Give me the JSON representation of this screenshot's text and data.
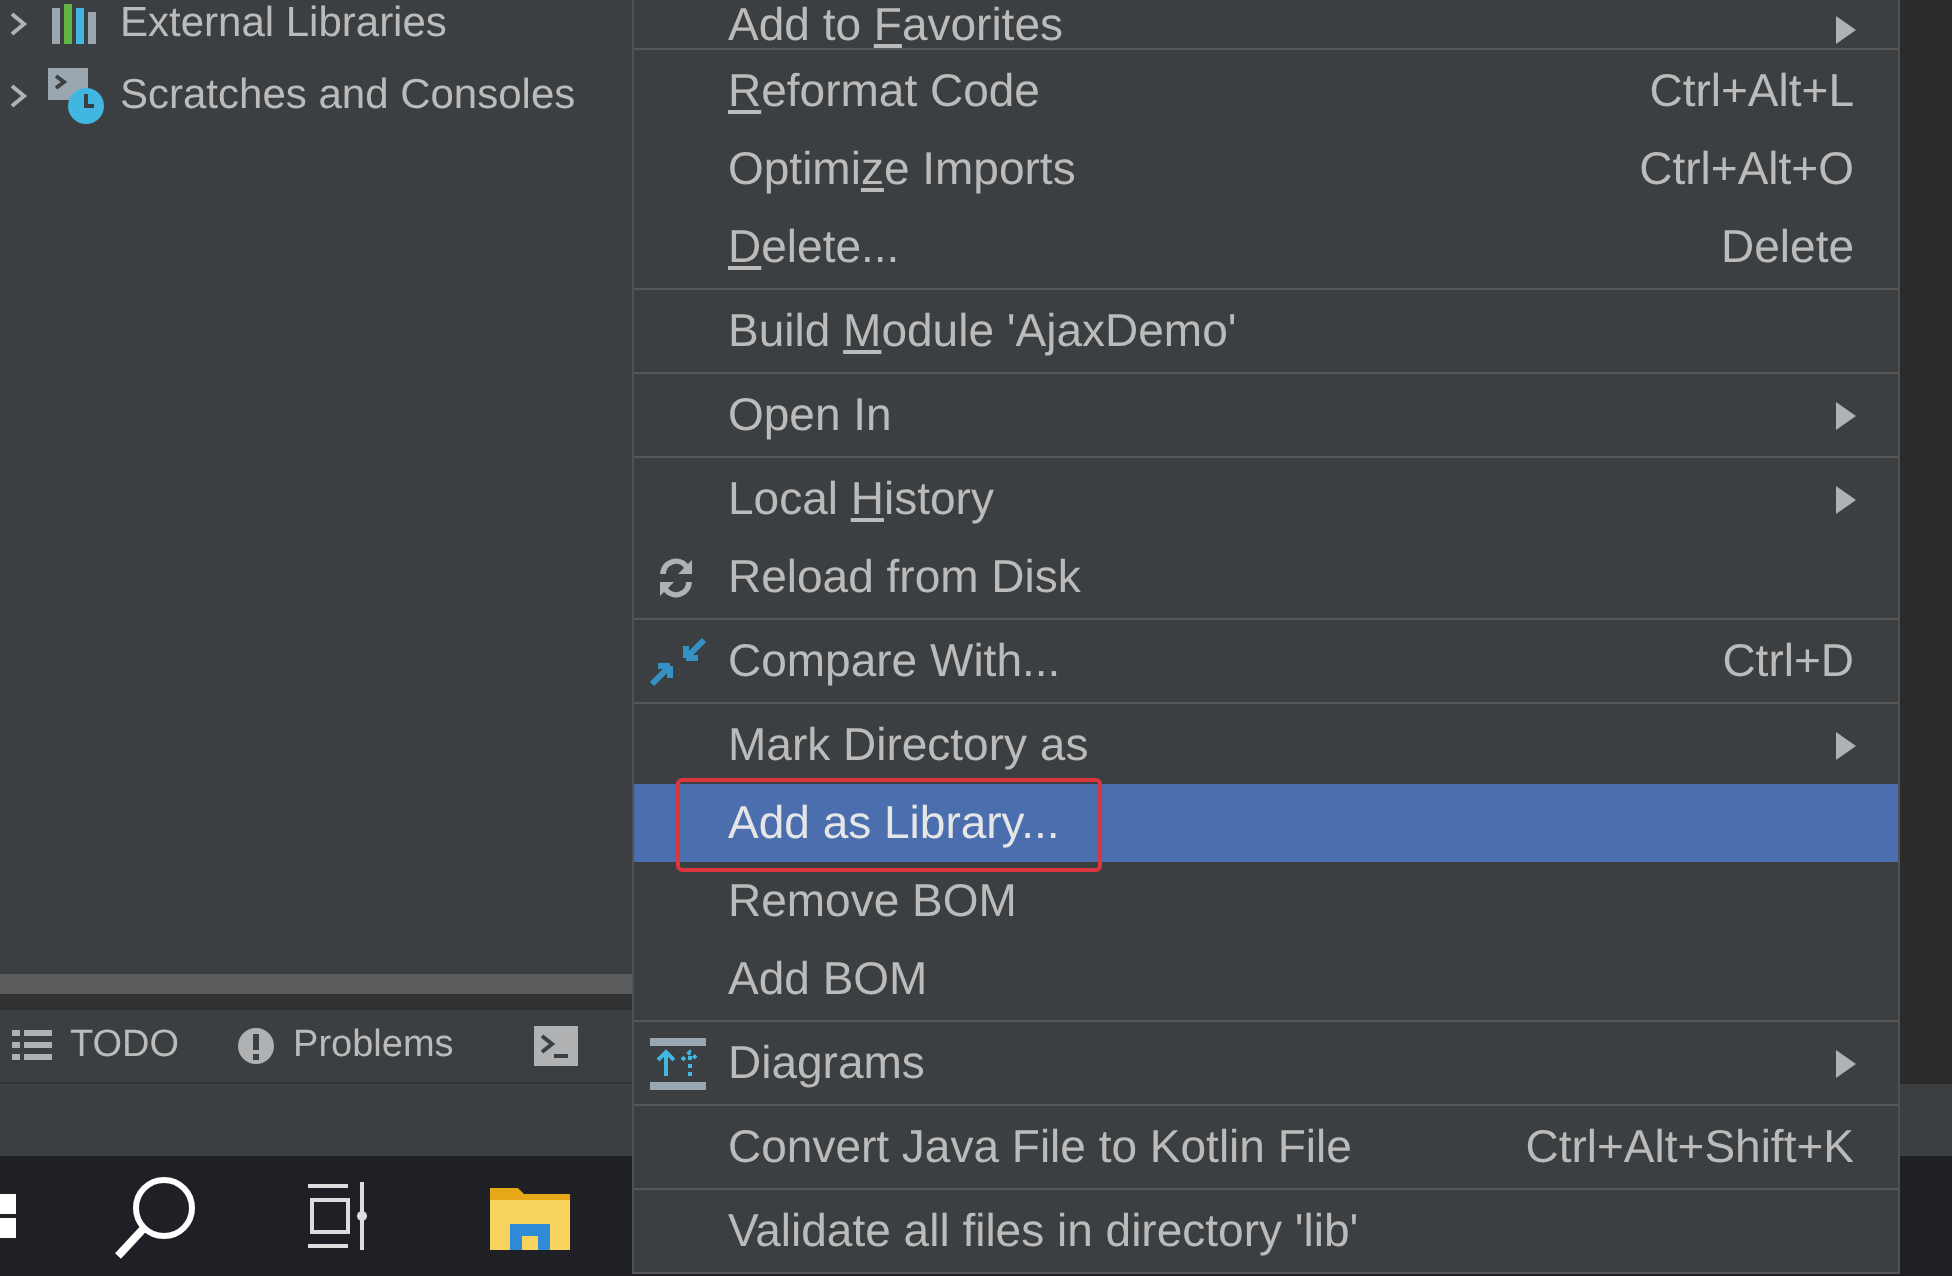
{
  "project_tree": {
    "items": [
      {
        "label": "External Libraries",
        "expanded": false,
        "kind": "libraries"
      },
      {
        "label": "Scratches and Consoles",
        "expanded": false,
        "kind": "scratches"
      }
    ]
  },
  "tool_window_bar": {
    "tabs": [
      {
        "label": "TODO",
        "kind": "list"
      },
      {
        "label": "Problems",
        "kind": "problems"
      }
    ]
  },
  "context_menu": {
    "groups": [
      [
        {
          "label_before": "Add to ",
          "mnemonic": "F",
          "label_after": "avorites",
          "submenu": true,
          "kind": "plain",
          "selected": false,
          "annotated": false
        }
      ],
      [
        {
          "mnemonic": "R",
          "label_after": "eformat Code",
          "shortcut": "Ctrl+Alt+L",
          "submenu": false,
          "kind": "plain",
          "selected": false,
          "annotated": false
        },
        {
          "label_before": "Optimi",
          "mnemonic": "z",
          "label_after": "e Imports",
          "shortcut": "Ctrl+Alt+O",
          "submenu": false,
          "kind": "plain",
          "selected": false,
          "annotated": false
        },
        {
          "mnemonic": "D",
          "label_after": "elete...",
          "shortcut": "Delete",
          "submenu": false,
          "kind": "plain",
          "selected": false,
          "annotated": false
        }
      ],
      [
        {
          "label_before": "Build ",
          "mnemonic": "M",
          "label_after": "odule 'AjaxDemo'",
          "submenu": false,
          "kind": "plain",
          "selected": false,
          "annotated": false
        }
      ],
      [
        {
          "label": "Open In",
          "submenu": true,
          "kind": "plain",
          "selected": false,
          "annotated": false
        }
      ],
      [
        {
          "label_before": "Local ",
          "mnemonic": "H",
          "label_after": "istory",
          "submenu": true,
          "kind": "plain",
          "selected": false,
          "annotated": false
        },
        {
          "label": "Reload from Disk",
          "submenu": false,
          "kind": "reload",
          "selected": false,
          "annotated": false
        }
      ],
      [
        {
          "label": "Compare With...",
          "shortcut": "Ctrl+D",
          "submenu": false,
          "kind": "compare",
          "selected": false,
          "annotated": false
        }
      ],
      [
        {
          "label": "Mark Directory as",
          "submenu": true,
          "kind": "plain",
          "selected": false,
          "annotated": false
        },
        {
          "label": "Add as Library...",
          "submenu": false,
          "kind": "plain",
          "selected": true,
          "annotated": true
        },
        {
          "label": "Remove BOM",
          "submenu": false,
          "kind": "plain",
          "selected": false,
          "annotated": false
        },
        {
          "label": "Add BOM",
          "submenu": false,
          "kind": "plain",
          "selected": false,
          "annotated": false
        }
      ],
      [
        {
          "label": "Diagrams",
          "submenu": true,
          "kind": "diagrams",
          "selected": false,
          "annotated": false
        }
      ],
      [
        {
          "label": "Convert Java File to Kotlin File",
          "shortcut": "Ctrl+Alt+Shift+K",
          "submenu": false,
          "kind": "plain",
          "selected": false,
          "annotated": false
        }
      ],
      [
        {
          "label": "Validate all files in directory 'lib'",
          "submenu": false,
          "kind": "plain",
          "selected": false,
          "annotated": false
        }
      ]
    ]
  }
}
